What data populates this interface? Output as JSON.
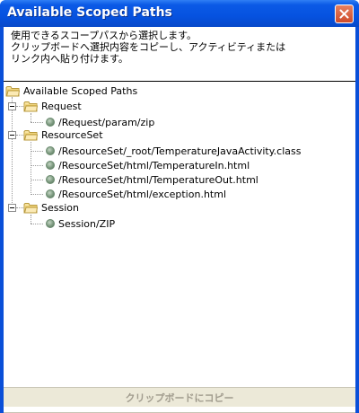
{
  "window": {
    "title": "Available Scoped Paths"
  },
  "description": {
    "lines": [
      "使用できるスコープパスから選択します。",
      "クリップボードへ選択内容をコピーし、アクティビティまたは",
      "リンク内へ貼り付けます。"
    ]
  },
  "tree": {
    "root": {
      "label": "Available Scoped Paths"
    },
    "groups": [
      {
        "label": "Request",
        "items": [
          "/Request/param/zip"
        ]
      },
      {
        "label": "ResourceSet",
        "items": [
          "/ResourceSet/_root/TemperatureJavaActivity.class",
          "/ResourceSet/html/TemperatureIn.html",
          "/ResourceSet/html/TemperatureOut.html",
          "/ResourceSet/html/exception.html"
        ]
      },
      {
        "label": "Session",
        "items": [
          "Session/ZIP"
        ]
      }
    ]
  },
  "footer": {
    "copy_button_label": "クリップボードにコピー"
  },
  "colors": {
    "titlebar": "#0652e0",
    "close_button": "#cf4b2a",
    "leaf_icon": "#7d9a80",
    "folder_icon": "#f4d889"
  }
}
